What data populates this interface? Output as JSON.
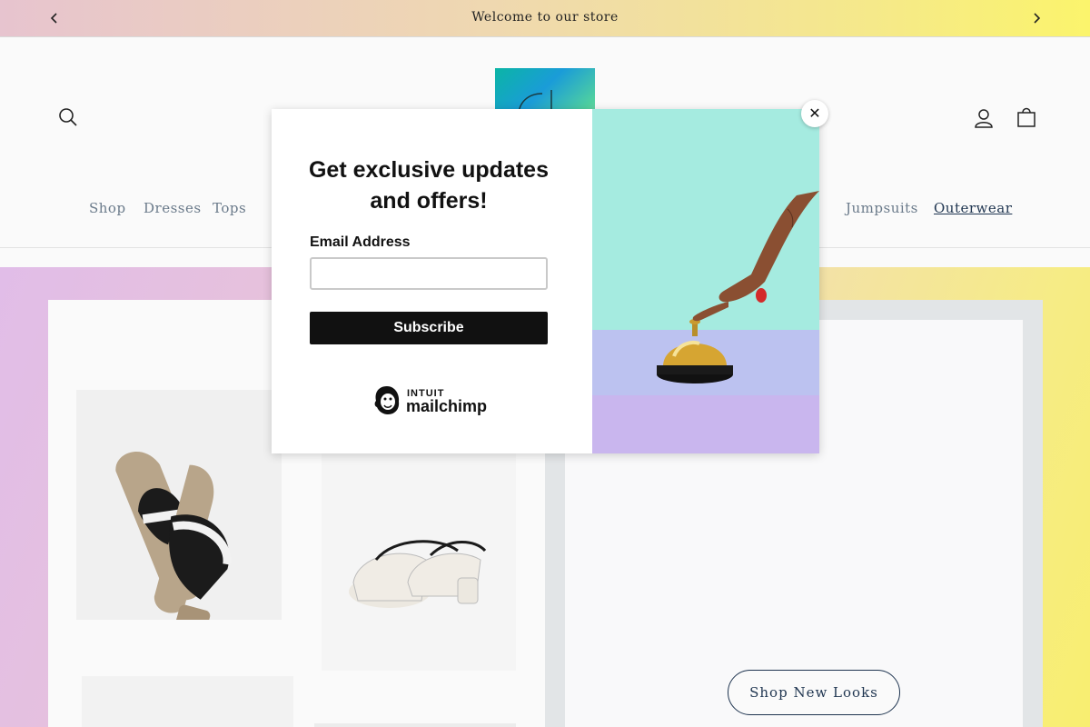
{
  "announcement": {
    "message": "Welcome to our store",
    "prev_icon": "chevron-left-icon",
    "next_icon": "chevron-right-icon"
  },
  "header": {
    "search_icon": "search-icon",
    "account_icon": "account-icon",
    "cart_icon": "cart-icon"
  },
  "nav": {
    "items": [
      {
        "label": "Shop"
      },
      {
        "label": "Dresses"
      },
      {
        "label": "Tops"
      },
      {
        "label": "Jumpsuits"
      },
      {
        "label": "Outerwear",
        "active": true
      }
    ]
  },
  "hero": {
    "cta_label": "Shop New Looks"
  },
  "popup": {
    "title": "Get exclusive updates and offers!",
    "email_label": "Email Address",
    "email_value": "",
    "subscribe_label": "Subscribe",
    "brand_top": "INTUIT",
    "brand_name": "mailchimp",
    "close_label": "✕"
  },
  "colors": {
    "accent": "#1f3550",
    "announcement_start": "#e7c4cf",
    "announcement_end": "#fbf46c",
    "popup_button": "#111111"
  }
}
